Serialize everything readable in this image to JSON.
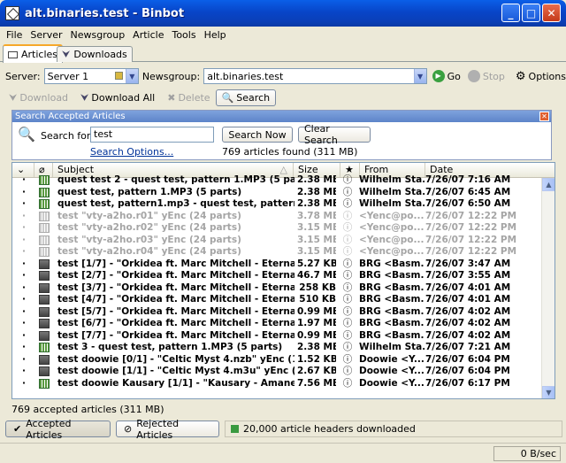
{
  "window": {
    "title": "alt.binaries.test - Binbot"
  },
  "menu": [
    "File",
    "Server",
    "Newsgroup",
    "Article",
    "Tools",
    "Help"
  ],
  "tabs": {
    "articles": "Articles",
    "downloads": "Downloads"
  },
  "server_bar": {
    "server_label": "Server:",
    "server_value": "Server 1",
    "newsgroup_label": "Newsgroup:",
    "newsgroup_value": "alt.binaries.test",
    "go": "Go",
    "stop": "Stop",
    "options": "Options"
  },
  "article_bar": {
    "download": "Download",
    "download_all": "Download All",
    "delete": "Delete",
    "search": "Search"
  },
  "search_panel": {
    "header": "Search Accepted Articles",
    "label": "Search for:",
    "value": "test",
    "search_now": "Search Now",
    "clear_search": "Clear Search",
    "search_options": "Search Options...",
    "found": "769 articles found (311 MB)"
  },
  "columns": {
    "subject": "Subject",
    "size": "Size",
    "from": "From",
    "date": "Date"
  },
  "rows": [
    {
      "subject": "quest test 2 - quest test, pattern 1.MP3 (5 parts)",
      "size": "2.38 MB",
      "from": "Wilhelm Sta...",
      "date": "7/26/07 7:16 AM",
      "kind": "file"
    },
    {
      "subject": "quest test, pattern 1.MP3 (5 parts)",
      "size": "2.38 MB",
      "from": "Wilhelm Sta...",
      "date": "7/26/07 6:45 AM",
      "kind": "file"
    },
    {
      "subject": "quest test, pattern1.mp3 - quest test, pattern 1...",
      "size": "2.38 MB",
      "from": "Wilhelm Sta...",
      "date": "7/26/07 6:50 AM",
      "kind": "file"
    },
    {
      "subject": "test \"vty-a2ho.r01\" yEnc (24 parts)",
      "size": "3.78 MB",
      "from": "<Yenc@po...",
      "date": "7/26/07 12:22 PM",
      "kind": "grey"
    },
    {
      "subject": "test \"vty-a2ho.r02\" yEnc (24 parts)",
      "size": "3.15 MB",
      "from": "<Yenc@po...",
      "date": "7/26/07 12:22 PM",
      "kind": "grey"
    },
    {
      "subject": "test \"vty-a2ho.r03\" yEnc (24 parts)",
      "size": "3.15 MB",
      "from": "<Yenc@po...",
      "date": "7/26/07 12:22 PM",
      "kind": "grey"
    },
    {
      "subject": "test \"vty-a2ho.r04\" yEnc (24 parts)",
      "size": "3.15 MB",
      "from": "<Yenc@po...",
      "date": "7/26/07 12:22 PM",
      "kind": "grey"
    },
    {
      "subject": "test [1/7] - \"Orkidea ft. Marc Mitchell - Eternal L...",
      "size": "5.27 KB",
      "from": "BRG <Basm...",
      "date": "7/26/07 3:47 AM",
      "kind": "rar"
    },
    {
      "subject": "test [2/7] - \"Orkidea ft. Marc Mitchell - Eternal L...",
      "size": "46.7 MB",
      "from": "BRG <Basm...",
      "date": "7/26/07 3:55 AM",
      "kind": "rar"
    },
    {
      "subject": "test [3/7] - \"Orkidea ft. Marc Mitchell - Eternal L...",
      "size": "258 KB",
      "from": "BRG <Basm...",
      "date": "7/26/07 4:01 AM",
      "kind": "rar"
    },
    {
      "subject": "test [4/7] - \"Orkidea ft. Marc Mitchell - Eternal L...",
      "size": "510 KB",
      "from": "BRG <Basm...",
      "date": "7/26/07 4:01 AM",
      "kind": "rar"
    },
    {
      "subject": "test [5/7] - \"Orkidea ft. Marc Mitchell - Eternal L...",
      "size": "0.99 MB",
      "from": "BRG <Basm...",
      "date": "7/26/07 4:02 AM",
      "kind": "rar"
    },
    {
      "subject": "test [6/7] - \"Orkidea ft. Marc Mitchell - Eternal L...",
      "size": "1.97 MB",
      "from": "BRG <Basm...",
      "date": "7/26/07 4:02 AM",
      "kind": "rar"
    },
    {
      "subject": "test [7/7] - \"Orkidea ft. Marc Mitchell - Eternal L...",
      "size": "0.99 MB",
      "from": "BRG <Basm...",
      "date": "7/26/07 4:02 AM",
      "kind": "rar"
    },
    {
      "subject": "test 3 - quest test, pattern 1.MP3 (5 parts)",
      "size": "2.38 MB",
      "from": "Wilhelm Sta...",
      "date": "7/26/07 7:21 AM",
      "kind": "file"
    },
    {
      "subject": "test doowie [0/1] - \"Celtic Myst 4.nzb\" yEnc (1 p...",
      "size": "1.52 KB",
      "from": "Doowie <Y...",
      "date": "7/26/07 6:04 PM",
      "kind": "rar"
    },
    {
      "subject": "test doowie [1/1] - \"Celtic Myst 4.m3u\" yEnc (1 ...",
      "size": "2.67 KB",
      "from": "Doowie <Y...",
      "date": "7/26/07 6:04 PM",
      "kind": "rar"
    },
    {
      "subject": "test doowie Kausary [1/1] - \"Kausary - Amanec...",
      "size": "7.56 MB",
      "from": "Doowie <Y...",
      "date": "7/26/07 6:17 PM",
      "kind": "file"
    }
  ],
  "status": {
    "accepted_count": "769 accepted articles (311 MB)",
    "accepted_tab": "Accepted Articles",
    "rejected_tab": "Rejected Articles",
    "headers_downloaded": "20,000 article headers downloaded",
    "speed": "0 B/sec"
  }
}
